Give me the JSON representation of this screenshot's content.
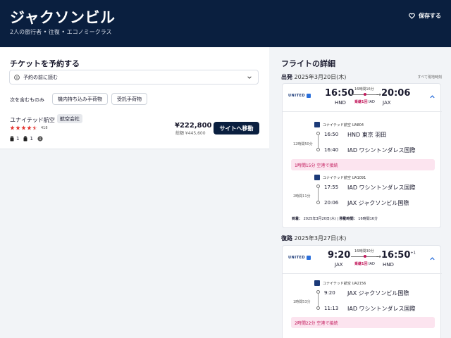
{
  "header": {
    "title": "ジャクソンビル",
    "subtitle": "2人の旅行者 • 往復 • エコノミークラス",
    "save_label": "保存する"
  },
  "booking": {
    "title": "チケットを予約する",
    "before_booking": "予約の前に読む",
    "includes_label": "次を含むものみ",
    "chips": [
      "機内持ち込み手荷物",
      "受託手荷物"
    ],
    "airline": "ユナイテッド航空",
    "airline_badge": "航空会社",
    "rating_stars": 4.5,
    "rating_count": "418",
    "carry_on_count": "1",
    "checked_count": "1",
    "price": "¥222,800",
    "price_total": "総額 ¥445,600",
    "goto_label": "サイトへ移動"
  },
  "details": {
    "title": "フライトの詳細",
    "local_time_note": "すべて現地時刻",
    "outbound": {
      "label": "出発",
      "date": "2025年3月20日(木)",
      "dep_time": "16:50",
      "arr_time": "20:06",
      "dep_code": "HND",
      "arr_code": "JAX",
      "duration": "16時間16分",
      "stop_pink": "乗継1回",
      "stop_code": "IAD",
      "airline_logo": "UNITED",
      "seg1": {
        "flight": "ユナイテッド航空 UA804",
        "duration": "12時間50分",
        "dep_time": "16:50",
        "dep_airport": "HND 東京 羽田",
        "arr_time": "16:40",
        "arr_airport": "IAD ワシントンダレス国際"
      },
      "layover": "1時間15分 空港で接続",
      "seg2": {
        "flight": "ユナイテッド航空 UA1091",
        "duration": "2時間11分",
        "dep_time": "17:55",
        "dep_airport": "IAD ワシントンダレス国際",
        "arr_time": "20:06",
        "arr_airport": "JAX ジャクソンビル国際"
      },
      "arrival_label": "到着：",
      "arrival_date": "2025年3月20日(木)",
      "travel_label": "移動時間：",
      "travel_time": "16時間16分"
    },
    "return": {
      "label": "復路",
      "date": "2025年3月27日(木)",
      "dep_time": "9:20",
      "arr_time": "16:50",
      "arr_plus": "+1",
      "dep_code": "JAX",
      "arr_code": "HND",
      "duration": "16時間30分",
      "stop_pink": "乗継1回",
      "stop_code": "IAD",
      "airline_logo": "UNITED",
      "seg1": {
        "flight": "ユナイテッド航空 UA2156",
        "duration": "1時間53分",
        "dep_time": "9:20",
        "dep_airport": "JAX ジャクソンビル国際",
        "arr_time": "11:13",
        "arr_airport": "IAD ワシントンダレス国際"
      },
      "layover": "2時間22分 空港で接続"
    }
  },
  "colors": {
    "header_bg": "#0a1f3f",
    "accent_pink": "#c2185b",
    "star": "#e53935"
  }
}
